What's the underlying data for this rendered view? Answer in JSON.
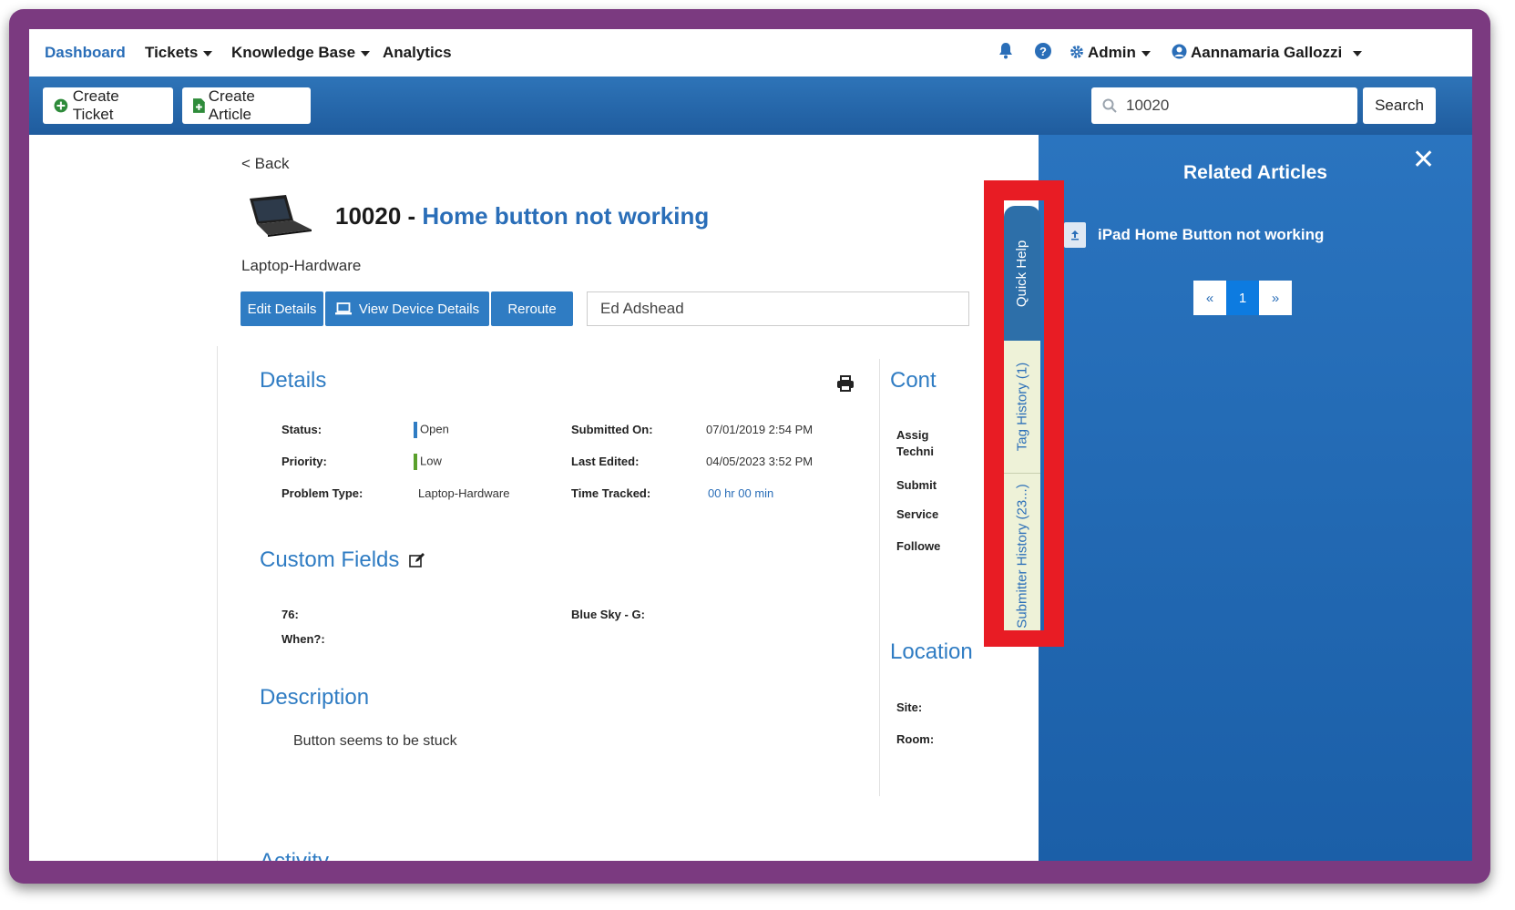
{
  "nav": {
    "dashboard": "Dashboard",
    "tickets": "Tickets",
    "knowledge_base": "Knowledge Base",
    "analytics": "Analytics",
    "admin": "Admin",
    "user": "Aannamaria Gallozzi"
  },
  "toolbar": {
    "create_ticket": "Create Ticket",
    "create_article": "Create Article",
    "search_value": "10020",
    "search_label": "Search"
  },
  "ticket": {
    "back": "< Back",
    "number_prefix": "10020 - ",
    "title": "Home button not working",
    "problem_type_heading": "Laptop-Hardware",
    "actions": {
      "edit_details": "Edit Details",
      "view_device_details": "View Device Details",
      "reroute": "Reroute"
    },
    "assignee": "Ed Adshead"
  },
  "details": {
    "heading": "Details",
    "status_label": "Status:",
    "status_value": "Open",
    "priority_label": "Priority:",
    "priority_value": "Low",
    "problem_type_label": "Problem Type:",
    "problem_type_value": "Laptop-Hardware",
    "submitted_on_label": "Submitted On:",
    "submitted_on_value": "07/01/2019 2:54 PM",
    "last_edited_label": "Last Edited:",
    "last_edited_value": "04/05/2023 3:52 PM",
    "time_tracked_label": "Time Tracked:",
    "time_tracked_value": "00 hr 00 min"
  },
  "custom_fields": {
    "heading": "Custom Fields",
    "field1_label": "76:",
    "field2_label": "When?:",
    "field3_label": "Blue Sky - G:"
  },
  "description": {
    "heading": "Description",
    "text": "Button seems to be stuck",
    "next_heading_partial": "Activity"
  },
  "contact": {
    "heading_partial": "Cont",
    "assigned_partial": "Assig",
    "tech_partial": "Techni",
    "submitter_partial": "Submit",
    "service_partial": "Service",
    "followers_partial": "Followe"
  },
  "location": {
    "heading_partial": "Location",
    "site_label": "Site:",
    "room_label": "Room:"
  },
  "side_tabs": {
    "quick_help": "Quick Help",
    "tag_history": "Tag History (1)",
    "submitter_history": "Submitter History (23...)"
  },
  "related": {
    "heading": "Related Articles",
    "close": "✕",
    "article": "iPad Home Button not working",
    "pagination": {
      "prev": "«",
      "current": "1",
      "next": "»"
    }
  },
  "colors": {
    "frame": "#7b3a80",
    "toolbar_blue": "#2368ad",
    "accent_blue": "#2f7cc3",
    "highlight_red": "#e81c24",
    "status_open": "#2f7cc3",
    "priority_low": "#5aa02c"
  }
}
